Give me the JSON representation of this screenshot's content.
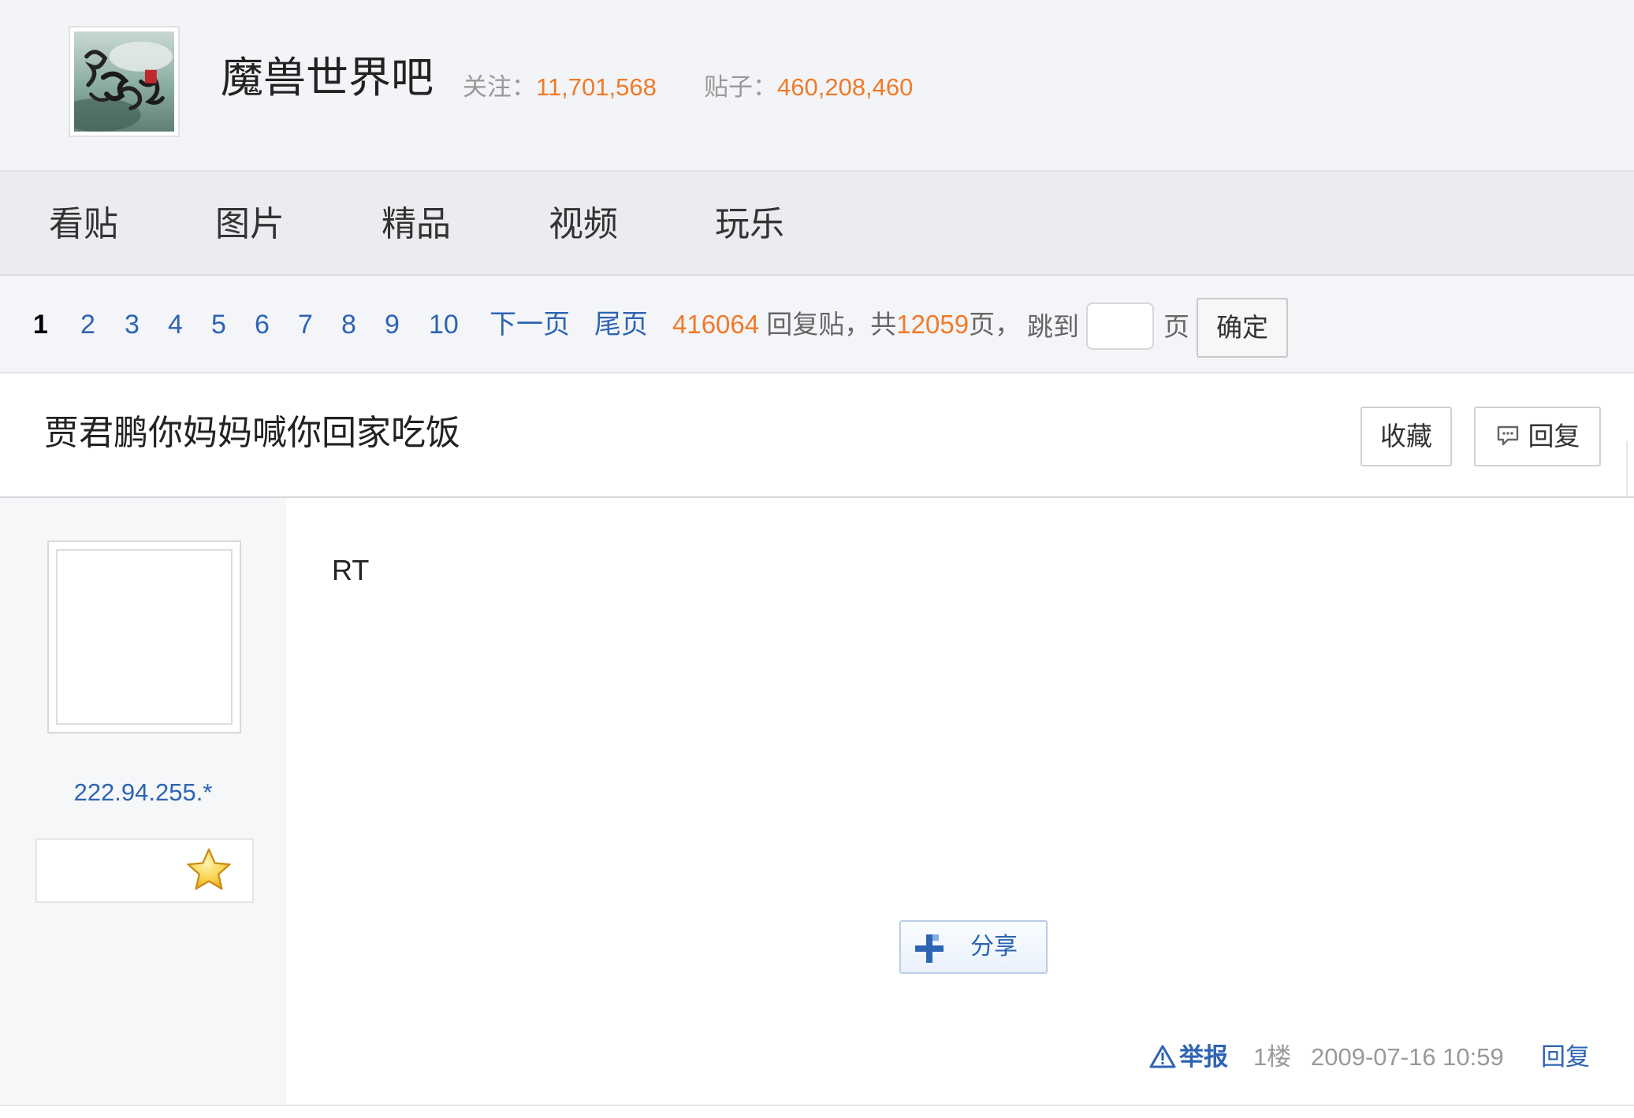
{
  "forum": {
    "name": "魔兽世界吧",
    "follow_label": "关注：",
    "follow_count": "11,701,568",
    "posts_label": "贴子：",
    "posts_count": "460,208,460"
  },
  "nav": {
    "tabs": [
      "看贴",
      "图片",
      "精品",
      "视频",
      "玩乐"
    ]
  },
  "pager": {
    "current": "1",
    "pages": [
      "2",
      "3",
      "4",
      "5",
      "6",
      "7",
      "8",
      "9",
      "10"
    ],
    "next_label": "下一页",
    "last_label": "尾页",
    "reply_count": "416064",
    "reply_label": " 回复贴，共",
    "page_total": "12059",
    "page_suffix": "页，",
    "jump_label": "跳到",
    "page_label": "页",
    "jump_value": "",
    "confirm_label": "确定"
  },
  "thread": {
    "title": "贾君鹏你妈妈喊你回家吃饭",
    "favorite_label": "收藏",
    "reply_label": "回复"
  },
  "post": {
    "author_ip": "222.94.255.*",
    "content": "RT",
    "share_label": "分享",
    "report_label": "举报",
    "floor": "1楼",
    "time": "2009-07-16 10:59",
    "reply_label": "回复"
  },
  "colors": {
    "accent_orange": "#f07a2a",
    "link_blue": "#2d64b3"
  },
  "icons": {
    "forum_logo": "calligraphy-logo",
    "reply": "speech-bubble-icon",
    "level": "star-icon",
    "share": "plus-icon",
    "report": "warning-triangle-icon"
  }
}
